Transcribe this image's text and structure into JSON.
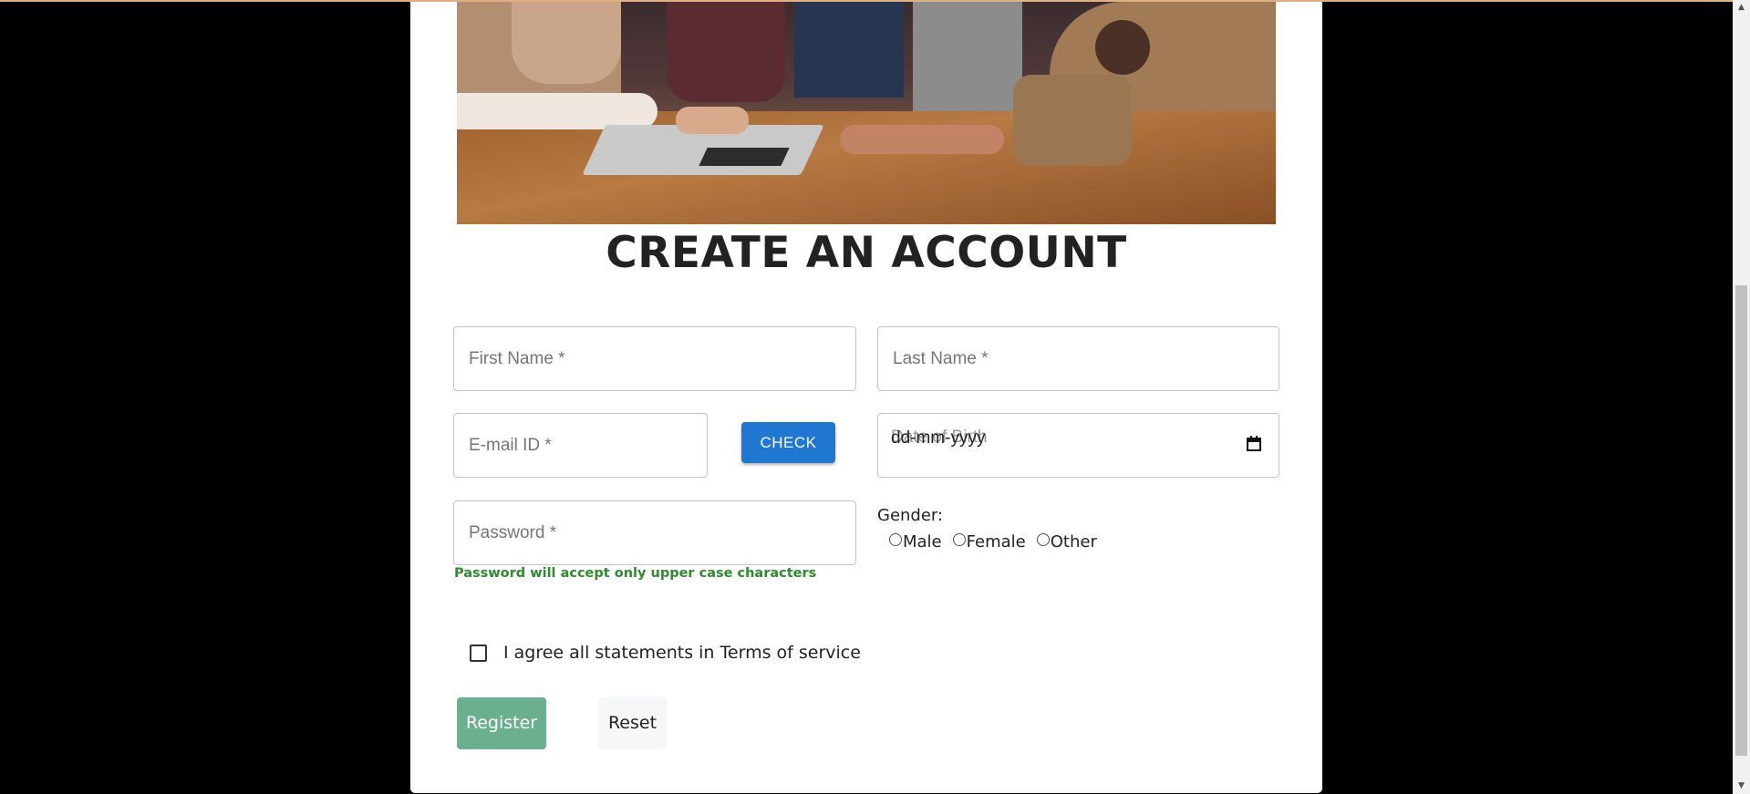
{
  "page": {
    "title": "CREATE AN ACCOUNT"
  },
  "form": {
    "first_name_placeholder": "First Name *",
    "last_name_placeholder": "Last Name *",
    "email_placeholder": "E-mail ID *",
    "check_label": "CHECK",
    "dob_placeholder": "Date of Birth",
    "dob_value": "dd-mm-yyyy",
    "password_placeholder": "Password *",
    "password_hint": "Password will accept only upper case characters",
    "gender_label": "Gender:",
    "gender_options": [
      "Male",
      "Female",
      "Other"
    ],
    "terms_label": "I agree all statements in Terms of service",
    "register_label": "Register",
    "reset_label": "Reset"
  },
  "icons": {
    "calendar": "calendar-icon",
    "scroll_up": "scroll-up-arrow-icon",
    "scroll_down": "scroll-down-arrow-icon"
  },
  "colors": {
    "check_button": "#1f77d2",
    "register_button": "#6ab08e",
    "password_hint": "#2e8b2e"
  }
}
